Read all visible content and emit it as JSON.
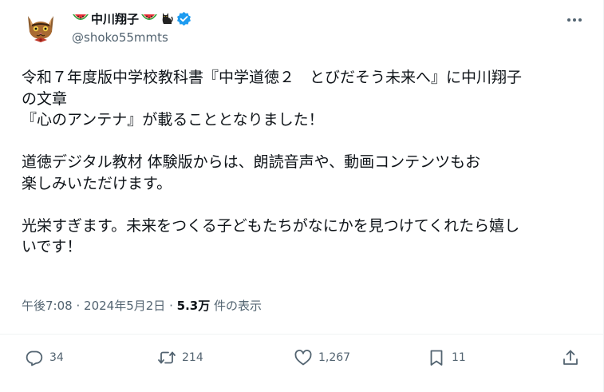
{
  "author": {
    "display_name": "中川翔子",
    "handle": "@shoko55mmts",
    "verified": true
  },
  "tweet": {
    "lines": [
      "令和７年度版中学校教科書『中学道徳２　とびだそう未来へ』に中川翔子",
      "の文章",
      "『心のアンテナ』が載ることとなりました！",
      "",
      "道徳デジタル教材 体験版からは、朗読音声￼や、動画コンテンツ￼もお",
      "楽しみいただけます。",
      "",
      "光栄すぎます。未来をつくる子どもたちがなにかを見つけてくれたら嬉し",
      "いです！"
    ]
  },
  "meta": {
    "time": "午後7:08",
    "date": "2024年5月2日",
    "separator": "·",
    "views_count": "5.3万",
    "views_label": "件の表示"
  },
  "actions": {
    "reply_count": "34",
    "repost_count": "214",
    "like_count": "1,267",
    "bookmark_count": "11"
  },
  "colors": {
    "text": "#0f1419",
    "secondary": "#536471",
    "verified": "#1d9bf0"
  },
  "icons": [
    "watermelon-icon",
    "black-cat-icon",
    "verified-badge-icon",
    "more-icon",
    "reply-icon",
    "repost-icon",
    "like-icon",
    "bookmark-icon",
    "share-icon"
  ]
}
